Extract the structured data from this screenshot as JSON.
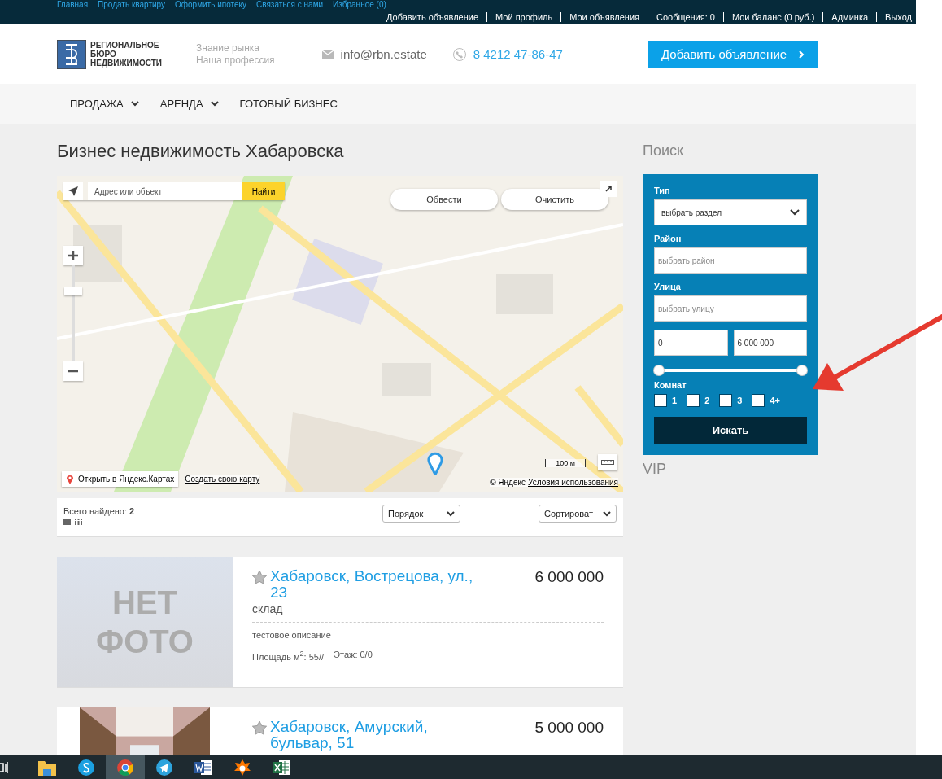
{
  "top_links": [
    "Главная",
    "Продать квартиру",
    "Оформить ипотеку",
    "Связаться с нами",
    "Избранное (0)"
  ],
  "user_menu": [
    "Добавить объявление",
    "Мой профиль",
    "Мои объявления",
    "Сообщения: 0",
    "Мои баланс (0 руб.)",
    "Админка",
    "Выход"
  ],
  "logo_lines": [
    "РЕГИОНАЛЬНОЕ",
    "БЮРО",
    "НЕДВИЖИМОСТИ"
  ],
  "tagline": [
    "Знание рынка",
    "Наша профессия"
  ],
  "email": "info@rbn.estate",
  "phone": "8 4212 47-86-47",
  "add_button": "Добавить объявление",
  "nav": [
    {
      "label": "ПРОДАЖА",
      "has_menu": true
    },
    {
      "label": "АРЕНДА",
      "has_menu": true
    },
    {
      "label": "ГОТОВЫЙ БИЗНЕС",
      "has_menu": false
    }
  ],
  "page_title": "Бизнес недвижимость Хабаровска",
  "map": {
    "kind": "picture",
    "search_placeholder": "Адрес или объект",
    "search_button": "Найти",
    "tools": [
      "Обвести",
      "Очистить"
    ],
    "zoom": {
      "level": 0.75
    },
    "open_link": "Открыть в Яндекс.Картах",
    "create_link": "Создать свою карту",
    "scale": "100 м",
    "copyright": "© Яндекс",
    "terms_link": "Условия использования"
  },
  "results": {
    "label": "Всего найдено:",
    "count": "2",
    "order_select": "Порядок",
    "sort_select": "Сортироват"
  },
  "listings": [
    {
      "kind": "no_photo",
      "no_photo_text": [
        "НЕТ",
        "ФОТО"
      ],
      "title": "Хабаровск, Вострецова, ул., 23",
      "type": "склад",
      "price": "6 000 000",
      "description": "тестовое описание",
      "area": "Площадь м$^{2}$: 55//",
      "floor": "Этаж: 0/0"
    },
    {
      "kind": "picture",
      "title": "Хабаровск, Амурский, бульвар, 51",
      "price": "5 000 000"
    }
  ],
  "sidebar": {
    "title": "Поиск",
    "type_label": "Тип",
    "type_select": "выбрать раздел",
    "district_label": "Район",
    "district_placeholder": "выбрать район",
    "street_label": "Улица",
    "street_placeholder": "выбрать улицу",
    "price_min": "0",
    "price_max": "6 000 000",
    "range": {
      "low": {
        "level": 0
      },
      "high": {
        "level": 1
      }
    },
    "rooms_label": "Комнат",
    "rooms": [
      {
        "label": "1",
        "checked": false
      },
      {
        "label": "2",
        "checked": false
      },
      {
        "label": "3",
        "checked": false
      },
      {
        "label": "4+",
        "checked": false
      }
    ],
    "search_button": "Искать",
    "vip_title": "VIP"
  },
  "taskbar": [
    {
      "kind": "folder",
      "selected": false
    },
    {
      "kind": "skype",
      "selected": false
    },
    {
      "kind": "chrome",
      "selected": true
    },
    {
      "kind": "telegram",
      "selected": false
    },
    {
      "kind": "word",
      "selected": false
    },
    {
      "kind": "avast",
      "selected": false
    },
    {
      "kind": "excel",
      "selected": false
    }
  ]
}
